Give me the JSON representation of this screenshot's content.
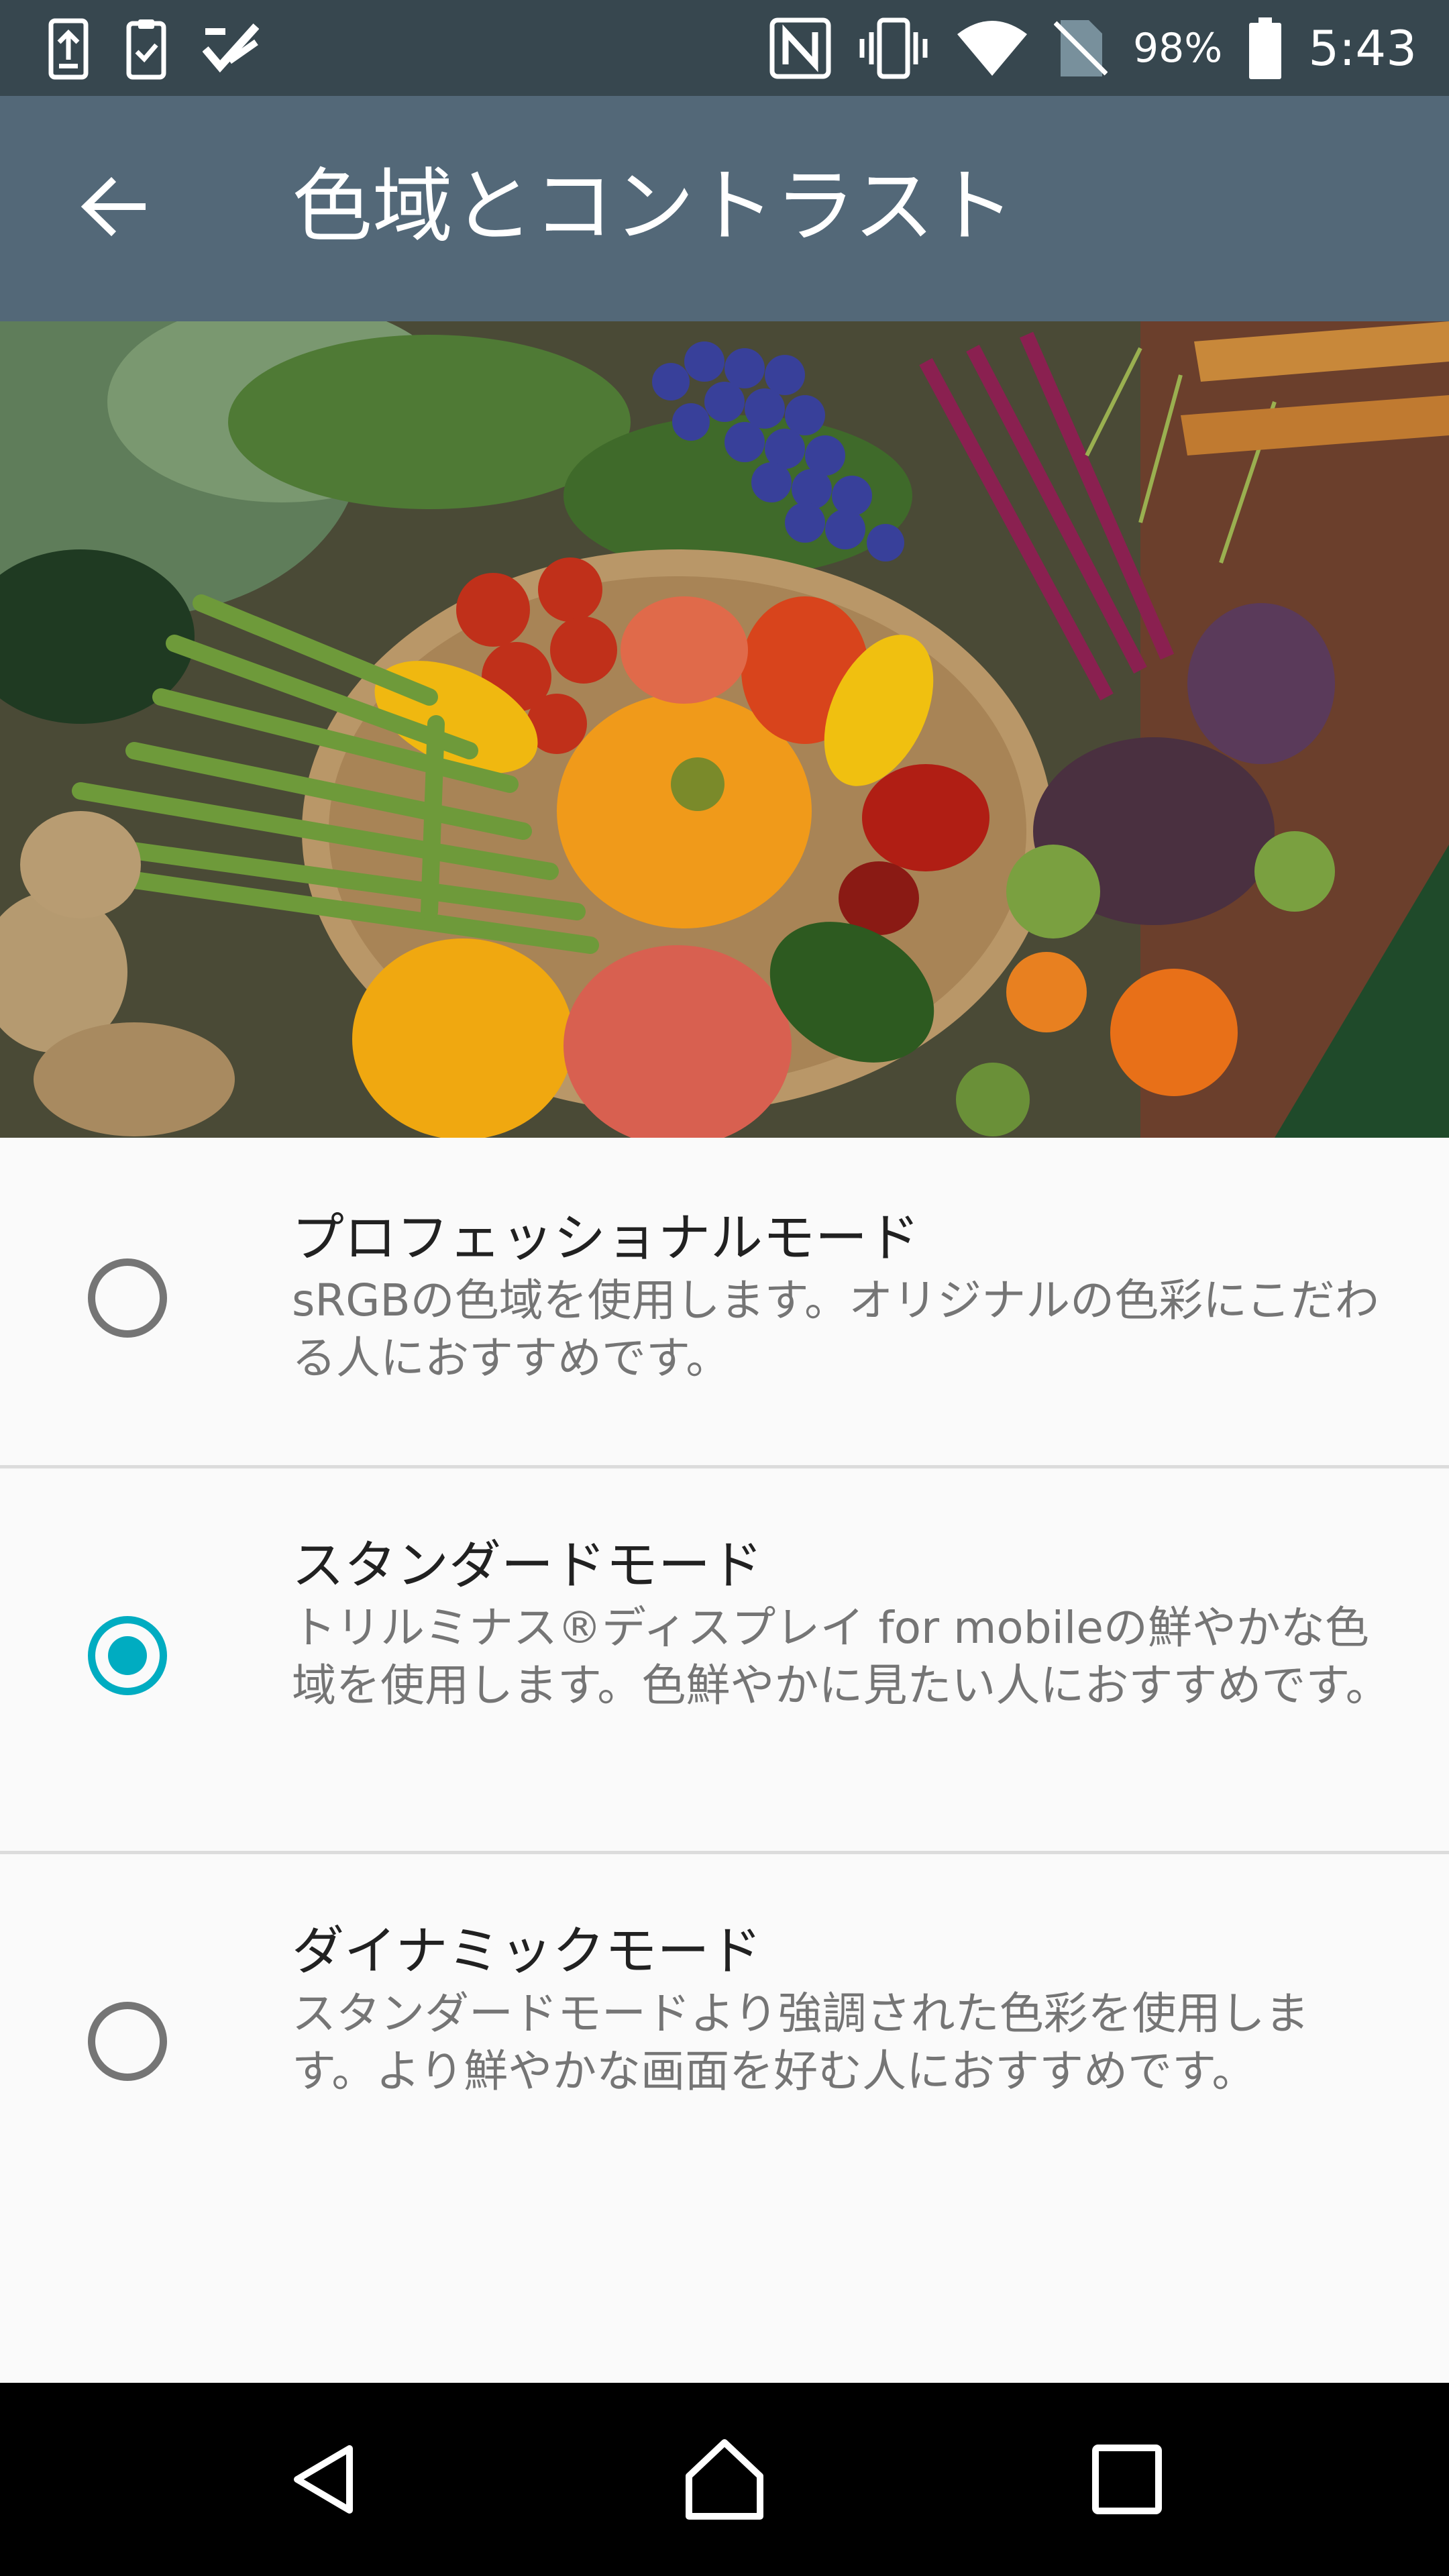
{
  "status_bar": {
    "left_icons": [
      "upload-status-icon",
      "clipboard-check-icon",
      "check-task-icon"
    ],
    "right_icons": [
      "nfc-icon",
      "vibrate-icon",
      "wifi-icon",
      "no-sim-icon",
      "battery-icon"
    ],
    "battery": "98%",
    "time": "5:43"
  },
  "app_bar": {
    "back_icon": "arrow-back-icon",
    "title": "色域とコントラスト"
  },
  "options": [
    {
      "title": "プロフェッショナルモード",
      "summary": "sRGBの色域を使用します。オリジナルの色彩にこだわる人におすすめです。",
      "checked": false
    },
    {
      "title": "スタンダードモード",
      "summary": "トリルミナス®ディスプレイ for mobileの鮮やかな色域を使用します。色鮮やかに見たい人におすすめです。",
      "checked": true
    },
    {
      "title": "ダイナミックモード",
      "summary": "スタンダードモードより強調された色彩を使用します。より鮮やかな画面を好む人におすすめです。",
      "checked": false
    }
  ],
  "colors": {
    "status_bar": "#37474f",
    "app_bar": "#536878",
    "accent": "#00acc1",
    "background": "#fafafa"
  },
  "nav_bar": {
    "buttons": [
      "back-triangle-icon",
      "home-icon",
      "recents-icon"
    ]
  }
}
